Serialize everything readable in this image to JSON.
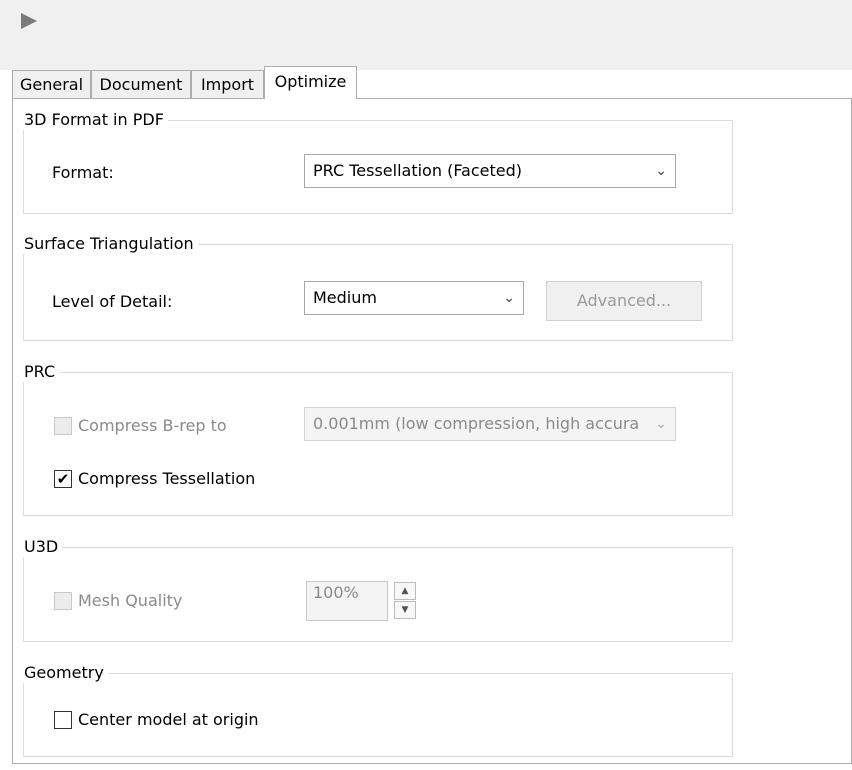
{
  "toolbar": {
    "play_icon": "play-triangle-icon"
  },
  "tabs": [
    {
      "label": "General"
    },
    {
      "label": "Document"
    },
    {
      "label": "Import"
    },
    {
      "label": "Optimize"
    }
  ],
  "active_tab": "Optimize",
  "format_group": {
    "legend": "3D Format in PDF",
    "format_label": "Format:",
    "format_value": "PRC Tessellation (Faceted)"
  },
  "surface_group": {
    "legend": "Surface Triangulation",
    "lod_label": "Level of Detail:",
    "lod_value": "Medium",
    "advanced_label": "Advanced..."
  },
  "prc_group": {
    "legend": "PRC",
    "compress_brep_label": "Compress B-rep to",
    "compress_brep_checked": false,
    "compress_brep_value": "0.001mm (low compression, high accura",
    "compress_tess_label": "Compress Tessellation",
    "compress_tess_checked": true,
    "check_mark": "✔"
  },
  "u3d_group": {
    "legend": "U3D",
    "mesh_quality_label": "Mesh Quality",
    "mesh_quality_checked": false,
    "mesh_quality_value": "100%"
  },
  "geometry_group": {
    "legend": "Geometry",
    "center_label": "Center model at origin",
    "center_checked": false
  },
  "icons": {
    "chevron": "⌄",
    "up": "▲",
    "down": "▼"
  }
}
